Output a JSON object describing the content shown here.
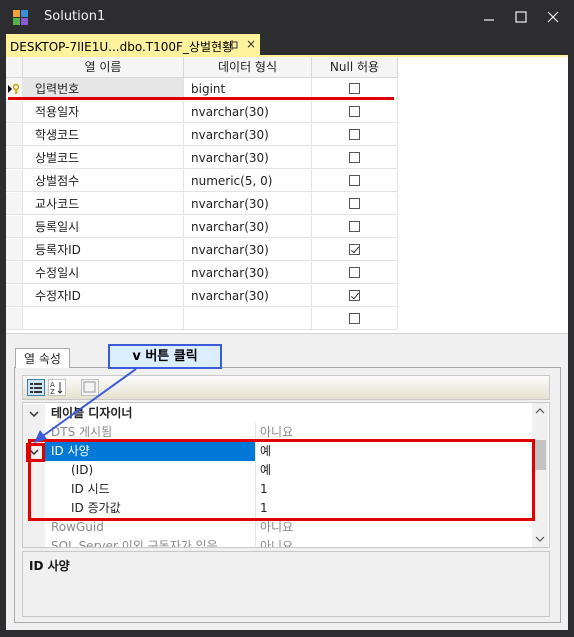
{
  "window": {
    "title": "Solution1",
    "controls": [
      "minimize",
      "maximize",
      "close"
    ]
  },
  "tab": {
    "label": "DESKTOP-7IIE1U...dbo.T100F_상벌현황",
    "pin_icon": "pin-icon",
    "close_glyph": "×"
  },
  "grid": {
    "headers": [
      "열 이름",
      "데이터 형식",
      "Null 허용"
    ],
    "rows": [
      {
        "name": "입력번호",
        "type": "bigint",
        "nullable": false,
        "primary_key": true
      },
      {
        "name": "적용일자",
        "type": "nvarchar(30)",
        "nullable": false
      },
      {
        "name": "학생코드",
        "type": "nvarchar(30)",
        "nullable": false
      },
      {
        "name": "상벌코드",
        "type": "nvarchar(30)",
        "nullable": false
      },
      {
        "name": "상벌점수",
        "type": "numeric(5, 0)",
        "nullable": false
      },
      {
        "name": "교사코드",
        "type": "nvarchar(30)",
        "nullable": false
      },
      {
        "name": "등록일시",
        "type": "nvarchar(30)",
        "nullable": false
      },
      {
        "name": "등록자ID",
        "type": "nvarchar(30)",
        "nullable": true
      },
      {
        "name": "수정일시",
        "type": "nvarchar(30)",
        "nullable": false
      },
      {
        "name": "수정자ID",
        "type": "nvarchar(30)",
        "nullable": true
      },
      {
        "name": "",
        "type": "",
        "nullable": false
      }
    ]
  },
  "properties": {
    "tab_label": "열 속성",
    "rows": [
      {
        "label": "테이블 디자이너",
        "value": "",
        "kind": "category"
      },
      {
        "label": "DTS 게시됨",
        "value": "아니요",
        "kind": "gray"
      },
      {
        "label": "ID 사양",
        "value": "예",
        "kind": "selected"
      },
      {
        "label": "(ID)",
        "value": "예",
        "kind": "child"
      },
      {
        "label": "ID 시드",
        "value": "1",
        "kind": "child"
      },
      {
        "label": "ID 증가값",
        "value": "1",
        "kind": "child"
      },
      {
        "label": "RowGuid",
        "value": "아니요",
        "kind": "gray"
      },
      {
        "label": "SQL Server 이외 구독자가 있음",
        "value": "아니요",
        "kind": "gray"
      }
    ],
    "description_title": "ID 사양"
  },
  "annotation": {
    "callout": "v 버튼 클릭"
  },
  "colors": {
    "tab_yellow": "#fff29d",
    "selection_blue": "#0078d7",
    "annotation_red": "#e00000",
    "callout_blue": "#3b5bd9"
  }
}
